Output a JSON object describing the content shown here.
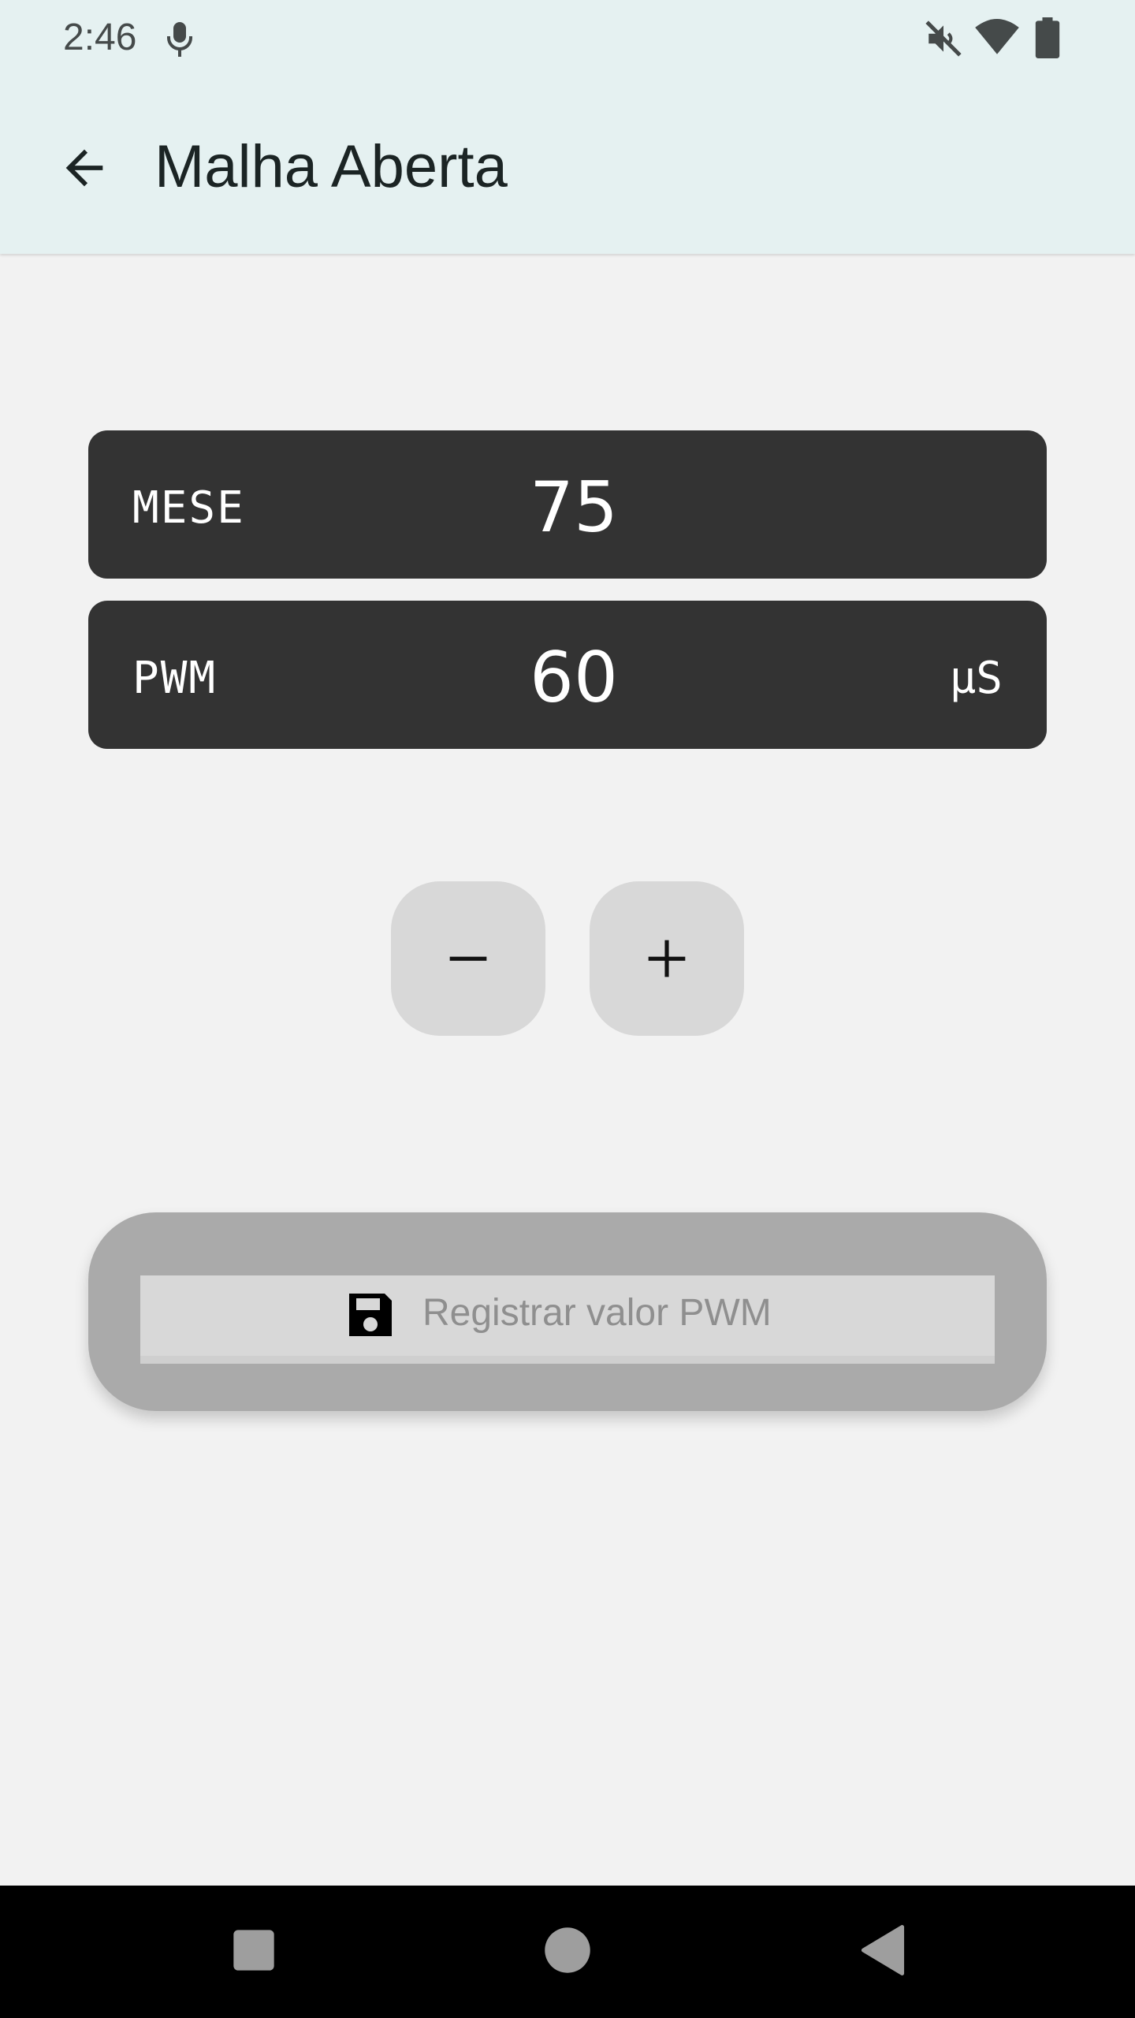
{
  "status_bar": {
    "time": "2:46",
    "icons": [
      "mic-icon",
      "mute-icon",
      "wifi-icon",
      "battery-icon"
    ]
  },
  "app_bar": {
    "title": "Malha Aberta",
    "back_icon": "arrow-left-icon"
  },
  "readouts": {
    "mese": {
      "label": "MESE",
      "value": "75"
    },
    "pwm": {
      "label": "PWM",
      "value": "60",
      "unit": "µS"
    }
  },
  "stepper": {
    "decrement_label": "−",
    "increment_label": "+"
  },
  "save_button": {
    "label": "Registrar valor PWM",
    "icon": "floppy-disk-icon"
  },
  "nav_bar": {
    "icons": [
      "recent-apps-icon",
      "home-icon",
      "back-icon"
    ]
  },
  "colors": {
    "app_bar_bg": "#e5f1f1",
    "background": "#f2f2f2",
    "panel_bg": "#333333",
    "button_bg": "#d8d8d8",
    "save_outer_bg": "#aaaaaa"
  }
}
